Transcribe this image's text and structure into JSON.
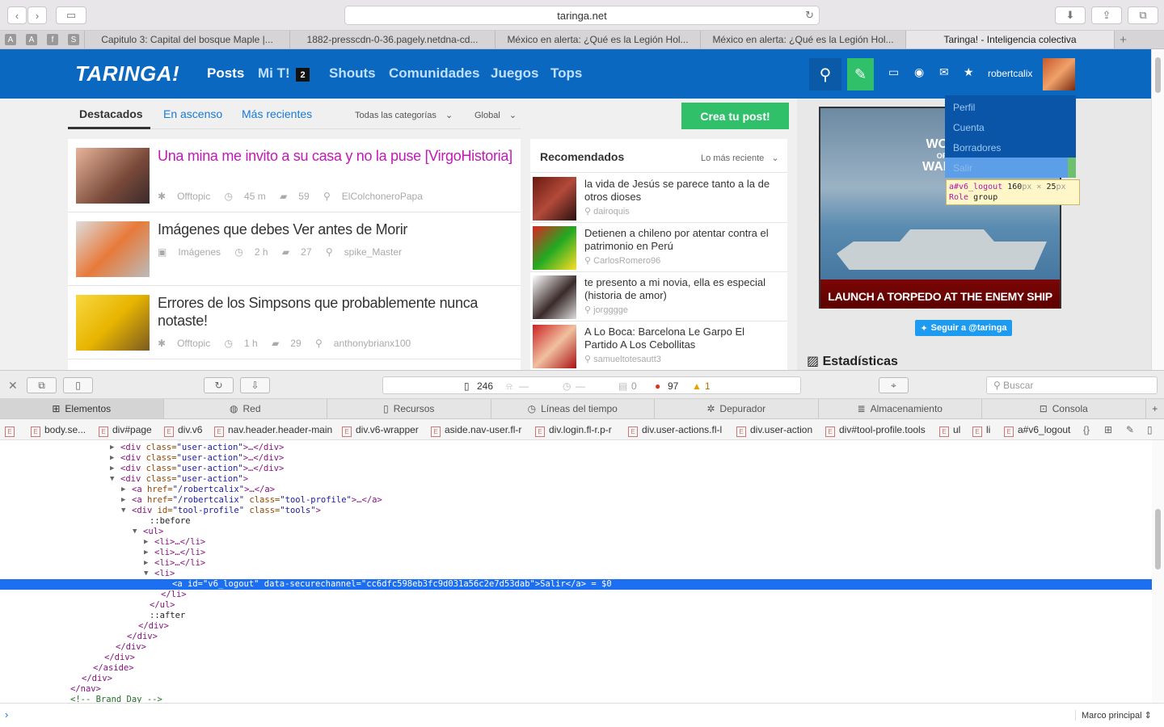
{
  "browser": {
    "url": "taringa.net",
    "tabs": [
      "Capitulo 3: Capital del bosque Maple |...",
      "1882-presscdn-0-36.pagely.netdna-cd...",
      "México en alerta: ¿Qué es la Legión Hol...",
      "México en alerta: ¿Qué es la Legión Hol...",
      "Taringa! - Inteligencia colectiva"
    ],
    "favorites": [
      "A",
      "A",
      "f",
      "S"
    ]
  },
  "site": {
    "logo": "TARINGA!",
    "nav": [
      "Posts",
      "Mi T!",
      "Shouts",
      "Comunidades",
      "Juegos",
      "Tops"
    ],
    "mit_badge": "2",
    "username": "robertcalix",
    "profile_menu": [
      "Perfil",
      "Cuenta",
      "Borradores",
      "Salir"
    ],
    "tooltip": {
      "id": "a#v6_logout",
      "w": "160",
      "px1": "px",
      "x": "×",
      "h": "25",
      "px2": "px",
      "role_label": "Role",
      "role": "group"
    }
  },
  "filters": {
    "tabs": [
      "Destacados",
      "En ascenso",
      "Más recientes"
    ],
    "category": "Todas las categorías",
    "scope": "Global",
    "create_post": "Crea tu post!"
  },
  "posts": [
    {
      "title": "Una mina me invito a su casa y no la puse [VirgoHistoria]",
      "category": "Offtopic",
      "time": "45 m",
      "comments": "59",
      "author": "ElColchoneroPapa"
    },
    {
      "title": "Imágenes que debes Ver antes de Morir",
      "category": "Imágenes",
      "time": "2 h",
      "comments": "27",
      "author": "spike_Master"
    },
    {
      "title": "Errores de los Simpsons que probablemente nunca notaste!",
      "category": "Offtopic",
      "time": "1 h",
      "comments": "29",
      "author": "anthonybrianx100"
    }
  ],
  "recommended": {
    "title": "Recomendados",
    "sort": "Lo más reciente",
    "items": [
      {
        "title": "la vida de Jesús se parece tanto a la de otros dioses",
        "author": "dairoquis"
      },
      {
        "title": "Detienen a chileno por atentar contra el patrimonio en Perú",
        "author": "CarlosRomero96"
      },
      {
        "title": "te presento a mi novia, ella es especial (historia de amor)",
        "author": "jorgggge"
      },
      {
        "title": "A Lo Boca: Barcelona Le Garpo El Partido A Los Cebollitas",
        "author": "samueltotesautt3"
      }
    ]
  },
  "sidebar": {
    "ad_logo": [
      "WOR",
      "OF",
      "WARS"
    ],
    "ad_cta": "LAUNCH A TORPEDO AT THE ENEMY SHIP",
    "follow": "Seguir a @taringa",
    "stats_title": "Estadísticas"
  },
  "devtools": {
    "resources": "246",
    "dash1": "—",
    "dash2": "—",
    "logs": "0",
    "errors": "97",
    "warnings": "1",
    "search_placeholder": "Buscar",
    "tabs": [
      "Elementos",
      "Red",
      "Recursos",
      "Líneas del tiempo",
      "Depurador",
      "Almacenamiento",
      "Consola"
    ],
    "breadcrumbs": [
      "body.se...",
      "div#page",
      "div.v6",
      "nav.header.header-main",
      "div.v6-wrapper",
      "aside.nav-user.fl-r",
      "div.login.fl-r.p-r",
      "div.user-actions.fl-l",
      "div.user-action",
      "div#tool-profile.tools",
      "ul",
      "li",
      "a#v6_logout"
    ],
    "dom": [
      {
        "i": 140,
        "arrow": "▶",
        "tag": "<div ",
        "attr": "class=",
        "val": "\"user-action\"",
        "rest": ">…</div>"
      },
      {
        "i": 140,
        "arrow": "▶",
        "tag": "<div ",
        "attr": "class=",
        "val": "\"user-action\"",
        "rest": ">…</div>"
      },
      {
        "i": 140,
        "arrow": "▶",
        "tag": "<div ",
        "attr": "class=",
        "val": "\"user-action\"",
        "rest": ">…</div>"
      },
      {
        "i": 140,
        "arrow": "▼",
        "tag": "<div ",
        "attr": "class=",
        "val": "\"user-action\"",
        "rest": ">"
      },
      {
        "i": 154,
        "arrow": "▶",
        "tag": "<a ",
        "attr": "href=",
        "val": "\"/robertcalix\"",
        "rest": ">…</a>"
      },
      {
        "i": 154,
        "arrow": "▶",
        "tag": "<a ",
        "attr": "href=",
        "val": "\"/robertcalix\" ",
        "attr2": "class=",
        "val2": "\"tool-profile\"",
        "rest": ">…</a>"
      },
      {
        "i": 154,
        "arrow": "▼",
        "tag": "<div ",
        "attr": "id=",
        "val": "\"tool-profile\" ",
        "attr2": "class=",
        "val2": "\"tools\"",
        "rest": ">"
      },
      {
        "i": 176,
        "arrow": "",
        "tag": "",
        "text": "::before"
      },
      {
        "i": 168,
        "arrow": "▼",
        "tag": "<ul>"
      },
      {
        "i": 182,
        "arrow": "▶",
        "tag": "<li>…</li>"
      },
      {
        "i": 182,
        "arrow": "▶",
        "tag": "<li>…</li>"
      },
      {
        "i": 182,
        "arrow": "▶",
        "tag": "<li>…</li>"
      },
      {
        "i": 182,
        "arrow": "▼",
        "tag": "<li>"
      },
      {
        "i": 204,
        "arrow": "",
        "tag": "<a ",
        "attr": "id=",
        "val": "\"v6_logout\" ",
        "attr2": "data-securechannel=",
        "val2": "\"cc6dfc598eb3fc9d031a56c2e7d53dab\"",
        "rest": ">",
        "text": "Salir",
        "rest2": "</a> = $0",
        "sel": true
      },
      {
        "i": 190,
        "arrow": "",
        "tag": "</li>"
      },
      {
        "i": 176,
        "arrow": "",
        "tag": "</ul>"
      },
      {
        "i": 176,
        "arrow": "",
        "tag": "",
        "text": "::after"
      },
      {
        "i": 162,
        "arrow": "",
        "tag": "</div>"
      },
      {
        "i": 148,
        "arrow": "",
        "tag": "</div>"
      },
      {
        "i": 134,
        "arrow": "",
        "tag": "</div>"
      },
      {
        "i": 120,
        "arrow": "",
        "tag": "</div>"
      },
      {
        "i": 106,
        "arrow": "",
        "tag": "</aside>"
      },
      {
        "i": 92,
        "arrow": "",
        "tag": "</div>"
      },
      {
        "i": 78,
        "arrow": "",
        "tag": "</nav>"
      },
      {
        "i": 78,
        "arrow": "",
        "tag": "",
        "comment": "<!-- Brand Day -->"
      }
    ],
    "frame": "Marco principal ⇕"
  }
}
